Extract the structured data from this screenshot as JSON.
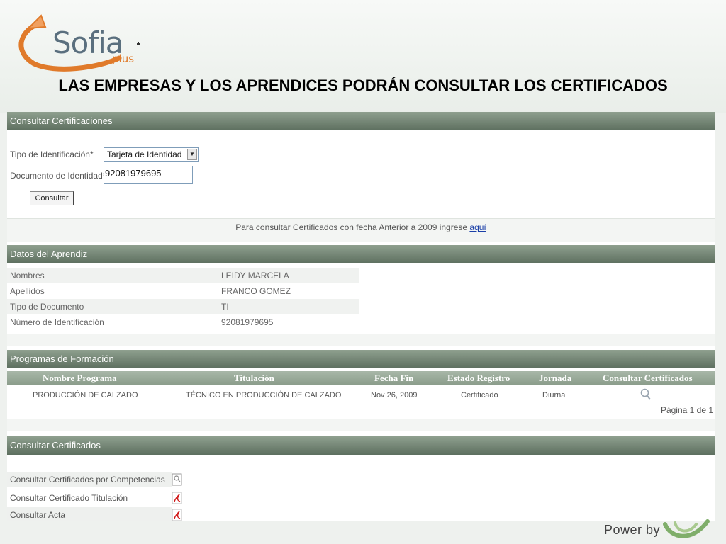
{
  "brand": {
    "logo_word": "Sofia",
    "logo_sub": "plus",
    "headline": "LAS EMPRESAS Y LOS APRENDICES PODRÁN CONSULTAR LOS CERTIFICADOS",
    "power_by": "Power by",
    "accent_orange": "#e07a2a",
    "section_green": "#6b7d6c"
  },
  "consulta": {
    "section_title": "Consultar Certificaciones",
    "tipo_label": "Tipo de Identificación*",
    "tipo_value": "Tarjeta de Identidad",
    "documento_label": "Documento de Identidad*",
    "documento_value": "92081979695",
    "consultar_button": "Consultar",
    "info_text": "Para consultar Certificados con fecha Anterior a 2009 ingrese ",
    "info_link": "aquí"
  },
  "aprendiz": {
    "section_title": "Datos del Aprendiz",
    "rows": [
      {
        "label": "Nombres",
        "value": "LEIDY MARCELA"
      },
      {
        "label": "Apellidos",
        "value": "FRANCO GOMEZ"
      },
      {
        "label": "Tipo de Documento",
        "value": "TI"
      },
      {
        "label": "Número de Identificación",
        "value": "92081979695"
      }
    ]
  },
  "programas": {
    "section_title": "Programas de Formación",
    "columns": [
      "Nombre Programa",
      "Titulación",
      "Fecha Fin",
      "Estado Registro",
      "Jornada",
      "Consultar Certificados"
    ],
    "rows": [
      [
        "PRODUCCIÓN DE CALZADO",
        "TÉCNICO EN PRODUCCIÓN DE CALZADO",
        "Nov 26, 2009",
        "Certificado",
        "Diurna"
      ]
    ],
    "pager": "Página 1 de 1"
  },
  "certificados": {
    "section_title": "Consultar Certificados",
    "items": [
      {
        "label": "Consultar Certificados por Competencias",
        "icon": "search-document-icon"
      },
      {
        "label": "Consultar Certificado Titulación",
        "icon": "pdf-icon"
      },
      {
        "label": "Consultar Acta",
        "icon": "pdf-icon"
      }
    ]
  }
}
